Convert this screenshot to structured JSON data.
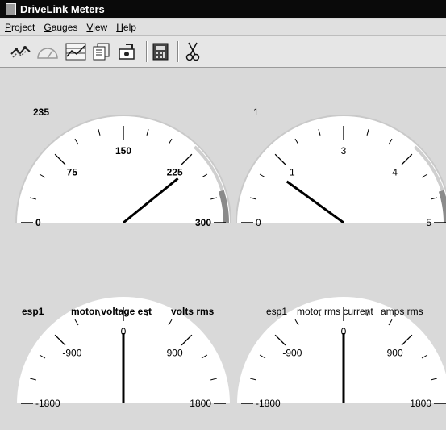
{
  "window": {
    "title": "DriveLink Meters"
  },
  "menu": [
    {
      "access": "P",
      "rest": "roject"
    },
    {
      "access": "G",
      "rest": "auges"
    },
    {
      "access": "V",
      "rest": "iew"
    },
    {
      "access": "H",
      "rest": "elp"
    }
  ],
  "toolbar": {
    "buttons": [
      {
        "icon": "connect-icon"
      },
      {
        "icon": "gauge-icon"
      },
      {
        "icon": "chart-icon"
      },
      {
        "icon": "pages-icon"
      },
      {
        "icon": "settings-icon"
      },
      {
        "icon": "calculator-icon"
      },
      {
        "icon": "scissors-icon"
      }
    ]
  },
  "gauges": [
    {
      "id": "motor-voltage",
      "min": 0,
      "max": 300,
      "value": 235,
      "readout": "235",
      "scale_labels": [
        "0",
        "75",
        "150",
        "225",
        "300"
      ],
      "label_parts": [
        "esp1",
        "motor voltage est",
        "volts rms"
      ],
      "bold": true,
      "warning_zone": [
        270,
        300
      ]
    },
    {
      "id": "motor-current",
      "min": 0,
      "max": 5,
      "value": 1,
      "readout": "1",
      "scale_labels": [
        "0",
        "1",
        "3",
        "4",
        "5"
      ],
      "label_parts": [
        "esp1",
        "motor rms current",
        "amps rms"
      ],
      "bold": false,
      "warning_zone": [
        4.5,
        5
      ]
    },
    {
      "id": "gauge-3",
      "min": -1800,
      "max": 1800,
      "value": 0,
      "scale_labels": [
        "-1800",
        "-900",
        "0",
        "900",
        "1800"
      ]
    },
    {
      "id": "gauge-4",
      "min": -1800,
      "max": 1800,
      "value": 0,
      "scale_labels": [
        "-1800",
        "-900",
        "0",
        "900",
        "1800"
      ]
    }
  ]
}
